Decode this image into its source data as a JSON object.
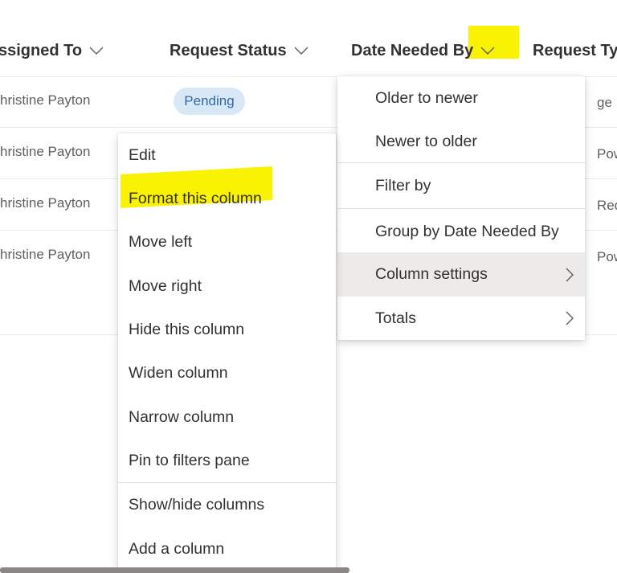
{
  "table": {
    "columns": [
      "ssigned To",
      "Request Status",
      "Date Needed By",
      "Request Ty"
    ],
    "rows": [
      {
        "assigned": "hristine Payton",
        "status": "Pending",
        "type": "ge Re"
      },
      {
        "assigned": "hristine Payton",
        "status": "",
        "type": "Powe"
      },
      {
        "assigned": "hristine Payton",
        "status": "",
        "type": "Reque"
      },
      {
        "assigned": "hristine Payton",
        "status": "",
        "type": "Powe"
      }
    ]
  },
  "column_menu": {
    "items": [
      "Older to newer",
      "Newer to older",
      "Filter by",
      "Group by Date Needed By",
      "Column settings",
      "Totals"
    ]
  },
  "settings_menu": {
    "items": [
      "Edit",
      "Format this column",
      "Move left",
      "Move right",
      "Hide this column",
      "Widen column",
      "Narrow column",
      "Pin to filters pane",
      "Show/hide columns",
      "Add a column"
    ]
  },
  "colors": {
    "highlight": "#f9f203",
    "pill_bg": "#d8e8f7",
    "pill_text": "#2f6aa6",
    "hover_bg": "#edebe9"
  },
  "icons": [
    "chevron-down-icon",
    "chevron-right-icon"
  ]
}
